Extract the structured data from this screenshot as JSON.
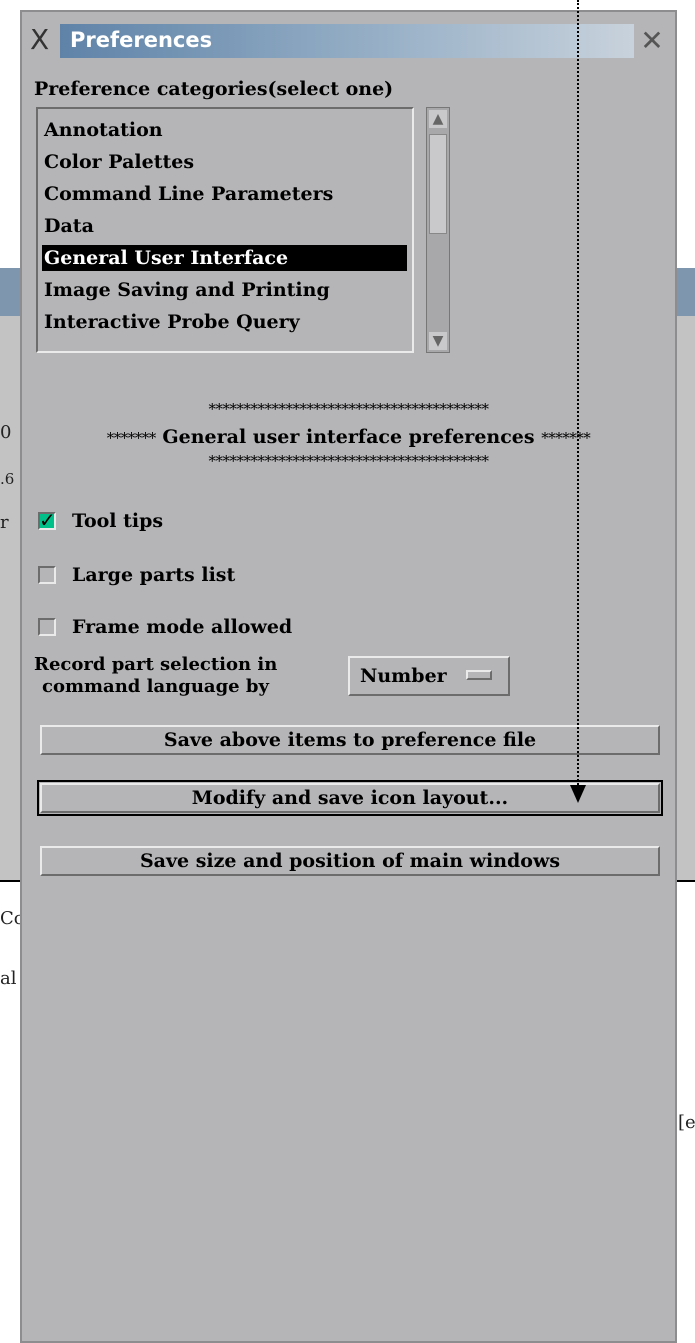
{
  "window": {
    "title": "Preferences",
    "title_icon": "x-logo-icon",
    "close_icon": "close-icon"
  },
  "categories": {
    "label": "Preference categories(select one)",
    "items": [
      "Annotation",
      "Color Palettes",
      "Command Line Parameters",
      "Data",
      "General User Interface",
      "Image Saving and Printing",
      "Interactive Probe Query"
    ],
    "selected": "General User Interface"
  },
  "section": {
    "stars_top": "****************************************",
    "heading_prefix": "*******",
    "heading": "General user interface preferences",
    "heading_suffix": "*******",
    "stars_bottom": "****************************************"
  },
  "options": {
    "tool_tips": {
      "label": "Tool tips",
      "checked": true
    },
    "large_parts_list": {
      "label": "Large parts list",
      "checked": false
    },
    "frame_mode": {
      "label": "Frame mode allowed",
      "checked": false
    }
  },
  "record": {
    "label_line1": "Record part selection in",
    "label_line2": "command language by",
    "value": "Number"
  },
  "buttons": {
    "save_items": "Save above items to preference file",
    "modify_icons": "Modify and save icon layout...",
    "save_size": "Save size and position of main windows"
  },
  "background_fragments": [
    "0",
    ".6",
    "r",
    "Cc",
    "al",
    "[e"
  ],
  "colors": {
    "panel": "#b5b5b8",
    "title_gradient_start": "#5f83a8",
    "selection": "#000000",
    "check_on": "#00c08a"
  }
}
